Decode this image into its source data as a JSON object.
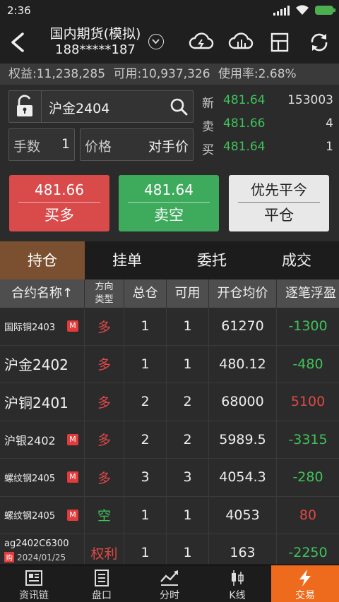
{
  "status_bar": {
    "time": "2:36"
  },
  "header": {
    "title": "国内期货(模拟)",
    "account": "188*****187"
  },
  "account_bar": {
    "equity": "权益:11,238,285",
    "available": "可用:10,937,326",
    "usage": "使用率:2.68%"
  },
  "order": {
    "contract": "沪金2404",
    "qty_label": "手数",
    "qty_value": "1",
    "price_label": "价格",
    "price_value": "对手价"
  },
  "quote": [
    {
      "label": "新",
      "price": "481.64",
      "volume": "153003"
    },
    {
      "label": "卖",
      "price": "481.66",
      "volume": "4"
    },
    {
      "label": "买",
      "price": "481.64",
      "volume": "1"
    }
  ],
  "buttons": {
    "buy_price": "481.66",
    "buy_label": "买多",
    "sell_price": "481.64",
    "sell_label": "卖空",
    "close_top": "优先平今",
    "close_label": "平仓"
  },
  "tabs": [
    "持仓",
    "挂单",
    "委托",
    "成交"
  ],
  "table": {
    "headers": {
      "name": "合约名称↑",
      "dir_line1": "方向",
      "dir_line2": "类型",
      "total": "总仓",
      "avail": "可用",
      "avg": "开仓均价",
      "pnl": "逐笔浮盈"
    },
    "rows": [
      {
        "name": "国际铜2403",
        "badge": "M",
        "dir": "多",
        "total": "1",
        "avail": "1",
        "avg": "61270",
        "pnl": "-1300"
      },
      {
        "name": "沪金2402",
        "badge": "",
        "dir": "多",
        "total": "1",
        "avail": "1",
        "avg": "480.12",
        "pnl": "-480"
      },
      {
        "name": "沪铜2401",
        "badge": "",
        "dir": "多",
        "total": "2",
        "avail": "2",
        "avg": "68000",
        "pnl": "5100"
      },
      {
        "name": "沪银2402",
        "badge": "M",
        "dir": "多",
        "total": "2",
        "avail": "2",
        "avg": "5989.5",
        "pnl": "-3315"
      },
      {
        "name": "螺纹钢2405",
        "badge": "M",
        "dir": "多",
        "total": "3",
        "avail": "3",
        "avg": "4054.3",
        "pnl": "-280"
      },
      {
        "name": "螺纹钢2405",
        "badge": "M",
        "dir": "空",
        "total": "1",
        "avail": "1",
        "avg": "4053",
        "pnl": "80"
      }
    ],
    "option_row": {
      "name": "ag2402C6300",
      "tag": "购",
      "date": "2024/01/25",
      "dir": "权利",
      "total": "1",
      "avail": "1",
      "avg": "163",
      "pnl": "-2250"
    }
  },
  "bottom_nav": [
    "资讯链",
    "盘口",
    "分时",
    "K线",
    "交易"
  ]
}
